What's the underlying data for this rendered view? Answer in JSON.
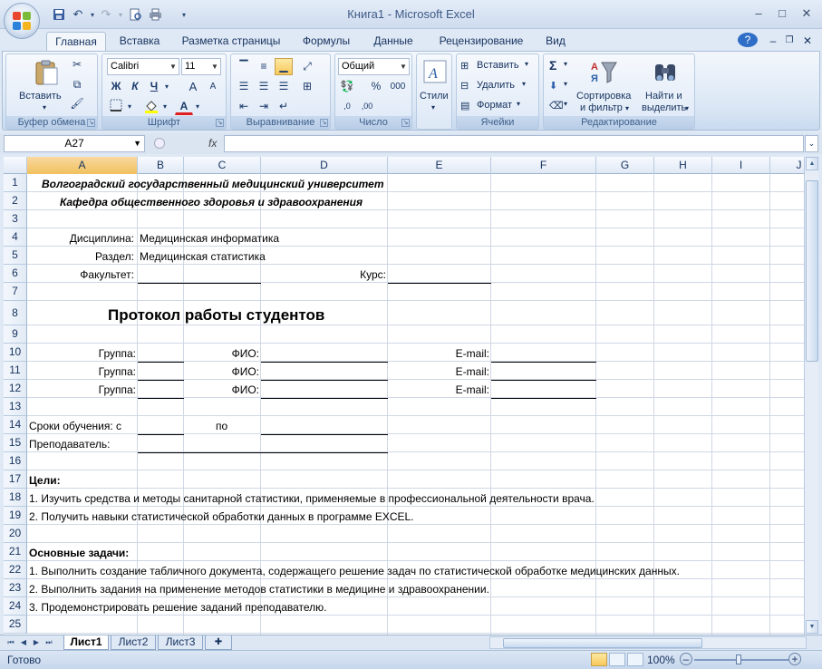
{
  "window": {
    "title": "Книга1 - Microsoft Excel",
    "minimize": "–",
    "maximize": "□",
    "close": "✕"
  },
  "quick_access": {
    "save_icon": "save-icon",
    "undo_icon": "undo-icon",
    "redo_icon": "redo-icon",
    "preview_icon": "print-preview-icon",
    "print_icon": "print-icon"
  },
  "tabs": [
    "Главная",
    "Вставка",
    "Разметка страницы",
    "Формулы",
    "Данные",
    "Рецензирование",
    "Вид"
  ],
  "ribbon": {
    "clipboard": {
      "label": "Буфер обмена",
      "paste": "Вставить"
    },
    "font": {
      "label": "Шрифт",
      "font_name": "Calibri",
      "font_size": "11",
      "bold": "Ж",
      "italic": "К",
      "underline": "Ч",
      "grow": "A",
      "shrink": "A",
      "font_color_letter": "A"
    },
    "alignment": {
      "label": "Выравнивание"
    },
    "number": {
      "label": "Число",
      "format": "Общий",
      "percent": "%",
      "thousands": "000"
    },
    "styles": {
      "label": "Стили"
    },
    "cells": {
      "label": "Ячейки",
      "insert": "Вставить",
      "delete": "Удалить",
      "format": "Формат"
    },
    "editing": {
      "label": "Редактирование",
      "sum": "Σ",
      "sort": "Сортировка",
      "sort2": "и фильтр",
      "find": "Найти и",
      "find2": "выделить"
    }
  },
  "formula_bar": {
    "name_box": "A27",
    "fx": "fx",
    "formula": ""
  },
  "columns": [
    "A",
    "B",
    "C",
    "D",
    "E",
    "F",
    "G",
    "H",
    "I",
    "J"
  ],
  "rows": [
    "1",
    "2",
    "3",
    "4",
    "5",
    "6",
    "7",
    "8",
    "9",
    "10",
    "11",
    "12",
    "13",
    "14",
    "15",
    "16",
    "17",
    "18",
    "19",
    "20",
    "21",
    "22",
    "23",
    "24",
    "25"
  ],
  "cells": {
    "r1": "Волгоградский государственный медицинский университет",
    "r2": "Кафедра общественного здоровья и здравоохранения",
    "r4_label": "Дисциплина:",
    "r4_value": "Медицинская информатика",
    "r5_label": "Раздел:",
    "r5_value": "Медицинская статистика",
    "r6_label": "Факультет:",
    "r6_course": "Курс:",
    "r8": "Протокол работы студентов",
    "group": "Группа:",
    "fio": "ФИО:",
    "email": "E-mail:",
    "r14_a": "Сроки обучения: с",
    "r14_c": "по",
    "r15": "Преподаватель:",
    "r17": "Цели:",
    "r18": "1. Изучить средства и методы санитарной статистики, применяемые в профессиональной деятельности врача.",
    "r19": "2. Получить навыки статистической обработки данных в программе EXCEL.",
    "r21": "Основные задачи:",
    "r22": "1. Выполнить создание табличного документа, содержащего решение  задач по статистической обработке медицинских данных.",
    "r23": "2. Выполнить задания на применение методов статистики в медицине и здравоохранении.",
    "r24": "3. Продемонстрировать решение заданий преподавателю."
  },
  "sheets": [
    "Лист1",
    "Лист2",
    "Лист3"
  ],
  "status": {
    "ready": "Готово",
    "zoom": "100%"
  }
}
